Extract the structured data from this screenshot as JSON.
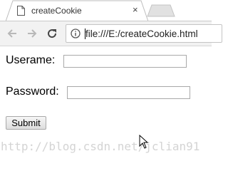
{
  "browser": {
    "tab": {
      "title": "createCookie",
      "close_glyph": "×",
      "favicon": "page-icon"
    },
    "new_tab": {
      "icon": "new-tab-icon"
    },
    "nav": {
      "back_icon": "back-arrow-icon",
      "forward_icon": "forward-arrow-icon",
      "reload_icon": "reload-icon"
    },
    "address_bar": {
      "info_icon": "info-icon",
      "url": "file:///E:/createCookie.html"
    }
  },
  "form": {
    "username_label": "Userame:",
    "username_value": "",
    "password_label": "Password:",
    "password_value": "",
    "submit_label": "Submit"
  },
  "watermark": "http://blog.csdn.net/jclian91",
  "colors": {
    "tab_bg": "#ffffff",
    "toolbar_bg": "#f2f2f2",
    "inactive_tab": "#e1e1e1",
    "watermark": "#d4d4d4"
  }
}
